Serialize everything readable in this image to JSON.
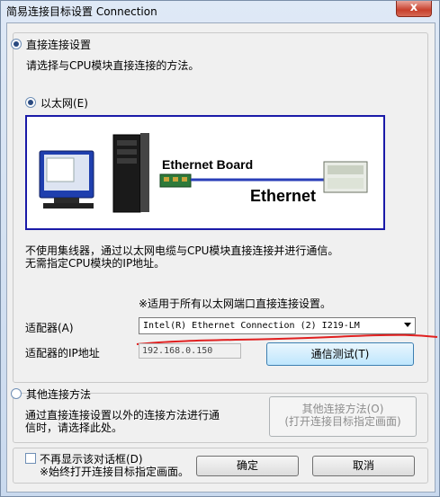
{
  "window": {
    "title": "简易连接目标设置 Connection",
    "close_glyph": "x"
  },
  "direct": {
    "radio_label": "直接连接设置",
    "description": "请选择与CPU模块直接连接的方法。"
  },
  "ethernet": {
    "radio_label": "以太网(E)",
    "illustration": {
      "board_label": "Ethernet Board",
      "network_label": "Ethernet"
    },
    "desc_line1": "不使用集线器，通过以太网电缆与CPU模块直接连接并进行通信。",
    "desc_line2": "无需指定CPU模块的IP地址。",
    "note": "※适用于所有以太网端口直接连接设置。",
    "adapter_label": "适配器(A)",
    "adapter_value": "Intel(R) Ethernet Connection (2) I219-LM",
    "ip_label": "适配器的IP地址",
    "ip_value": "192.168.0.150",
    "test_button": "通信测试(T)"
  },
  "other": {
    "radio_label": "其他连接方法",
    "desc_line1": "通过直接连接设置以外的连接方法进行通",
    "desc_line2": "信时，请选择此处。",
    "button_line1": "其他连接方法(O)",
    "button_line2": "(打开连接目标指定画面)"
  },
  "footer": {
    "checkbox_line1": "不再显示该对话框(D)",
    "checkbox_line2": "※始终打开连接目标指定画面。",
    "ok": "确定",
    "cancel": "取消"
  },
  "colors": {
    "illustration_border": "#1a1aa8",
    "annotation_stroke": "#e02020"
  }
}
